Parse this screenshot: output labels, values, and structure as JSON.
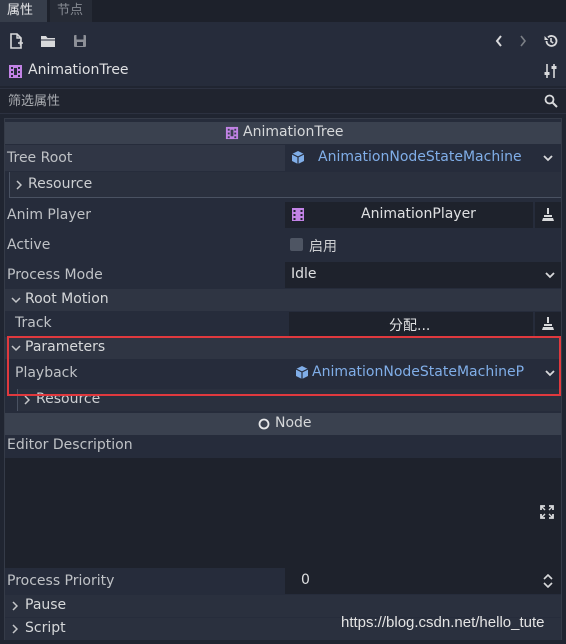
{
  "tabs": [
    {
      "label": "属性",
      "active": true
    },
    {
      "label": "节点",
      "active": false
    }
  ],
  "toolbar": {
    "icons": [
      "new-resource-icon",
      "open-folder-icon",
      "save-icon",
      "history-back-icon",
      "history-forward-icon",
      "object-history-icon"
    ]
  },
  "object": {
    "name": "AnimationTree",
    "icon": "animation-tree-icon"
  },
  "filter": {
    "placeholder": "筛选属性"
  },
  "inspector": {
    "header_title": "AnimationTree",
    "tree_root": {
      "label": "Tree Root",
      "value": "AnimationNodeStateMachine"
    },
    "resource_label": "Resource",
    "anim_player": {
      "label": "Anim Player",
      "value": "AnimationPlayer"
    },
    "active": {
      "label": "Active",
      "checkbox_label": "启用",
      "checked": false
    },
    "process_mode": {
      "label": "Process Mode",
      "value": "Idle"
    },
    "root_motion": {
      "label": "Root Motion"
    },
    "track": {
      "label": "Track",
      "value": "分配..."
    },
    "parameters": {
      "label": "Parameters"
    },
    "playback": {
      "label": "Playback",
      "value": "AnimationNodeStateMachinePl"
    },
    "resource2_label": "Resource",
    "node_header": "Node",
    "editor_description": {
      "label": "Editor Description",
      "value": ""
    },
    "process_priority": {
      "label": "Process Priority",
      "value": "0"
    },
    "pause": {
      "label": "Pause"
    },
    "script": {
      "label": "Script"
    }
  },
  "watermark": "https://blog.csdn.net/hello_tute",
  "colors": {
    "accent": "#80aee8",
    "highlight_box": "#e0393e",
    "animation_icon": "#c283e6"
  }
}
